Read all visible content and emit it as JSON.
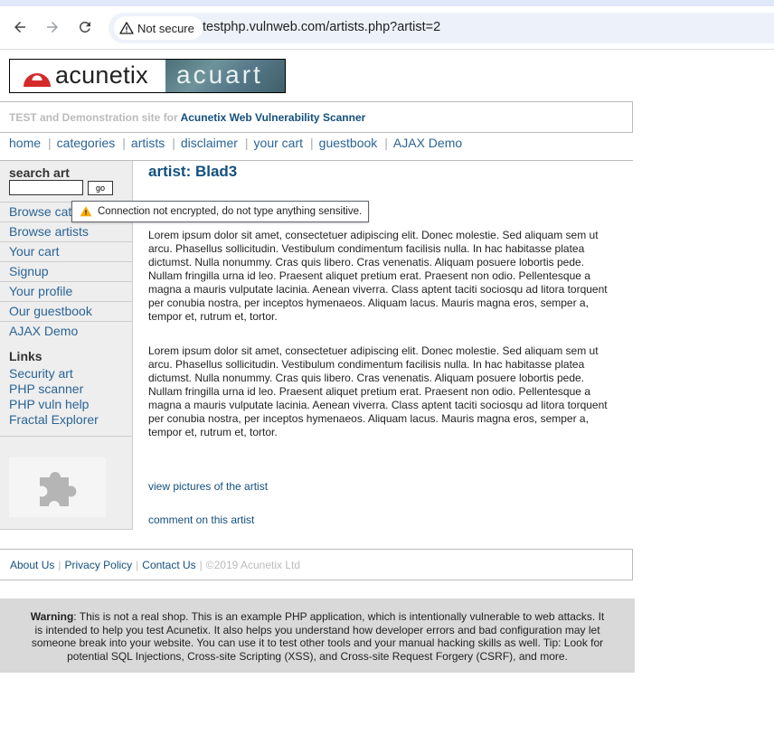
{
  "browser": {
    "security_label": "Not secure",
    "url": "testphp.vulnweb.com/artists.php?artist=2"
  },
  "logo": {
    "left_text": "acunetix",
    "right_text": "acuart"
  },
  "banner": {
    "prefix": "TEST and Demonstration site for ",
    "product": "Acunetix Web Vulnerability Scanner"
  },
  "topnav": {
    "items": [
      "home",
      "categories",
      "artists",
      "disclaimer",
      "your cart",
      "guestbook",
      "AJAX Demo"
    ],
    "separator": "|"
  },
  "sidebar": {
    "search_title": "search art",
    "search_value": "",
    "go_label": "go",
    "links": [
      "Browse categories",
      "Browse artists",
      "Your cart",
      "Signup",
      "Your profile",
      "Our guestbook",
      "AJAX Demo"
    ],
    "links_title": "Links",
    "external_links": [
      "Security art",
      "PHP scanner",
      "PHP vuln help",
      "Fractal Explorer"
    ],
    "plugin_icon": "puzzle-piece-icon"
  },
  "tooltip": {
    "text": "Connection not encrypted, do not type anything sensitive."
  },
  "main": {
    "title": "artist: Blad3",
    "paragraphs": [
      "Lorem ipsum dolor sit amet, consectetuer adipiscing elit. Donec molestie. Sed aliquam sem ut arcu. Phasellus sollicitudin. Vestibulum condimentum facilisis nulla. In hac habitasse platea dictumst. Nulla nonummy. Cras quis libero. Cras venenatis. Aliquam posuere lobortis pede. Nullam fringilla urna id leo. Praesent aliquet pretium erat. Praesent non odio. Pellentesque a magna a mauris vulputate lacinia. Aenean viverra. Class aptent taciti sociosqu ad litora torquent per conubia nostra, per inceptos hymenaeos. Aliquam lacus. Mauris magna eros, semper a, tempor et, rutrum et, tortor.",
      "Lorem ipsum dolor sit amet, consectetuer adipiscing elit. Donec molestie. Sed aliquam sem ut arcu. Phasellus sollicitudin. Vestibulum condimentum facilisis nulla. In hac habitasse platea dictumst. Nulla nonummy. Cras quis libero. Cras venenatis. Aliquam posuere lobortis pede. Nullam fringilla urna id leo. Praesent aliquet pretium erat. Praesent non odio. Pellentesque a magna a mauris vulputate lacinia. Aenean viverra. Class aptent taciti sociosqu ad litora torquent per conubia nostra, per inceptos hymenaeos. Aliquam lacus. Mauris magna eros, semper a, tempor et, rutrum et, tortor."
    ],
    "view_pictures_link": "view pictures of the artist",
    "comment_link": "comment on this artist"
  },
  "footer": {
    "links": [
      "About Us",
      "Privacy Policy",
      "Contact Us"
    ],
    "separator": "|",
    "copyright": "©2019 Acunetix Ltd"
  },
  "warning": {
    "label": "Warning",
    "text": ": This is not a real shop. This is an example PHP application, which is intentionally vulnerable to web attacks. It is intended to help you test Acunetix. It also helps you understand how developer errors and bad configuration may let someone break into your website. You can use it to test other tools and your manual hacking skills as well. Tip: Look for potential SQL Injections, Cross-site Scripting (XSS), and Cross-site Request Forgery (CSRF), and more."
  },
  "colors": {
    "link_blue": "#2a6496",
    "heading_blue": "#14507d",
    "sidebar_bg": "#eeeeee",
    "warning_bg": "#d9d9d9",
    "logo_red": "#d52a2a"
  }
}
